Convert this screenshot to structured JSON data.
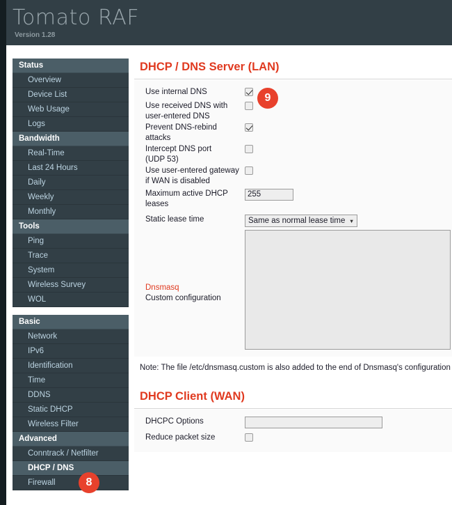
{
  "header": {
    "title": "Tomato RAF",
    "version": "Version 1.28"
  },
  "sidebar": {
    "groups": [
      {
        "section": "Status",
        "items": [
          "Overview",
          "Device List",
          "Web Usage",
          "Logs"
        ]
      },
      {
        "section": "Bandwidth",
        "items": [
          "Real-Time",
          "Last 24 Hours",
          "Daily",
          "Weekly",
          "Monthly"
        ]
      },
      {
        "section": "Tools",
        "items": [
          "Ping",
          "Trace",
          "System",
          "Wireless Survey",
          "WOL"
        ]
      },
      {
        "section": "Basic",
        "items": [
          "Network",
          "IPv6",
          "Identification",
          "Time",
          "DDNS",
          "Static DHCP",
          "Wireless Filter"
        ]
      },
      {
        "section": "Advanced",
        "items": [
          "Conntrack / Netfilter",
          "DHCP / DNS",
          "Firewall"
        ]
      }
    ],
    "active_item": "DHCP / DNS"
  },
  "main": {
    "lan_section": {
      "title": "DHCP / DNS Server (LAN)",
      "rows": {
        "use_internal_dns": {
          "label": "Use internal DNS",
          "checked": true
        },
        "use_received_dns": {
          "label_line1": "Use received DNS with",
          "label_line2": "user-entered DNS",
          "checked": false
        },
        "prevent_rebind": {
          "label_line1": "Prevent DNS-rebind",
          "label_line2": "attacks",
          "checked": true
        },
        "intercept_dns": {
          "label_line1": "Intercept DNS port",
          "label_line2": "(UDP 53)",
          "checked": false
        },
        "user_gateway": {
          "label_line1": "Use user-entered gateway",
          "label_line2": "if WAN is disabled",
          "checked": false
        },
        "max_leases": {
          "label_line1": "Maximum active DHCP",
          "label_line2": "leases",
          "value": "255"
        },
        "static_lease_time": {
          "label": "Static lease time",
          "value": "Same as normal lease time"
        },
        "dnsmasq": {
          "label_line1": "Dnsmasq",
          "label_line2": "Custom configuration",
          "value": ""
        }
      },
      "note": "Note: The file /etc/dnsmasq.custom is also added to the end of Dnsmasq's configuration file if it"
    },
    "wan_section": {
      "title": "DHCP Client (WAN)",
      "rows": {
        "dhcpc_options": {
          "label": "DHCPC Options",
          "value": ""
        },
        "reduce_packet_size": {
          "label": "Reduce packet size",
          "checked": false
        }
      }
    }
  },
  "badges": {
    "sidebar_badge": "8",
    "content_badge": "9",
    "color": "#e8412c"
  }
}
